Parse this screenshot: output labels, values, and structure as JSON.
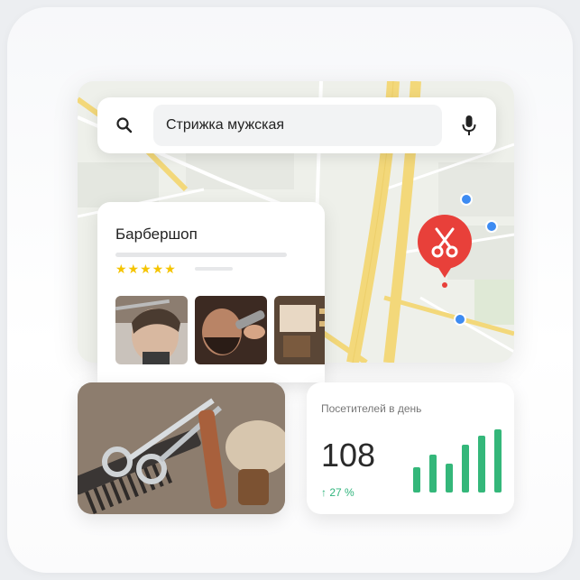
{
  "search": {
    "query": "Стрижка мужская",
    "icons": [
      "search-icon",
      "microphone-icon"
    ]
  },
  "place": {
    "title": "Барбершоп",
    "rating_stars": 5,
    "stars_text": "★★★★★"
  },
  "map": {
    "marker_icon": "scissors-icon",
    "marker_color": "#e8403a",
    "dot_color": "#3d8bf2",
    "road_color": "#f3d87a"
  },
  "stats": {
    "label": "Посетителей в день",
    "value": "108",
    "change": "↑ 27 %",
    "change_color": "#2fb47c",
    "bar_color": "#34b77a",
    "bars": [
      0.4,
      0.6,
      0.45,
      0.75,
      0.9,
      1.0
    ]
  }
}
